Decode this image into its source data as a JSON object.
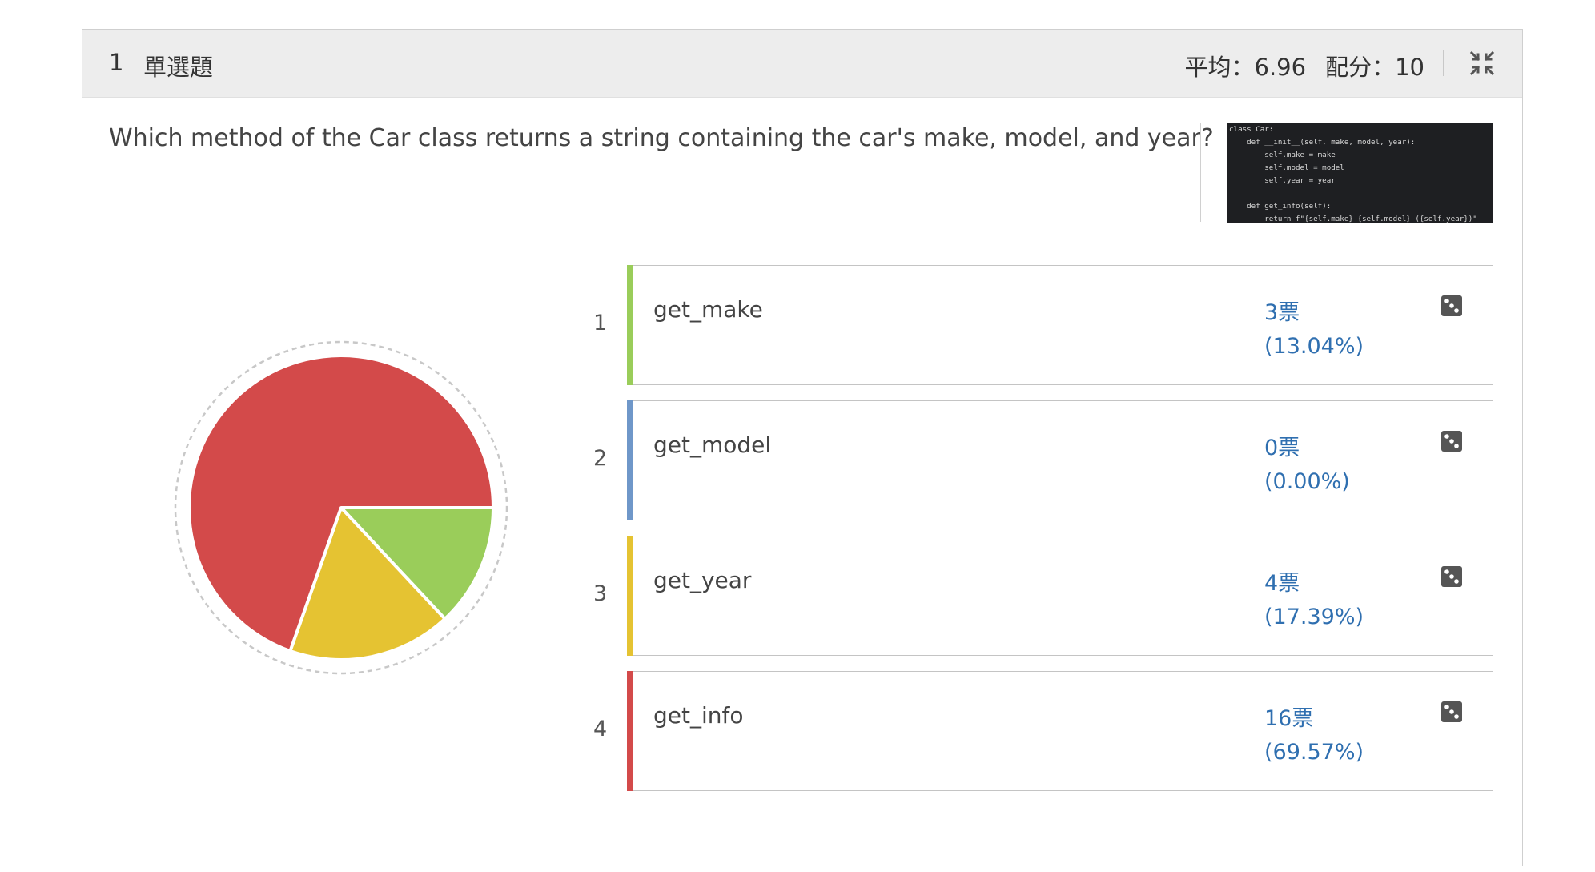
{
  "question": {
    "number": "1",
    "type": "單選題",
    "average_text": "平均：6.96",
    "score_text": "配分：10",
    "text": "Which method of the Car class returns a string containing the car's make, model, and year?",
    "code_lines": [
      "class Car:",
      "    def __init__(self, make, model, year):",
      "        self.make = make",
      "        self.model = model",
      "        self.year = year",
      "",
      "    def get_info(self):",
      "        return f\"{self.make} {self.model} ({self.year})\""
    ]
  },
  "options": [
    {
      "index": "1",
      "label": "get_make",
      "votes": "3票",
      "percent": "(13.04%)",
      "color": "#9acd5a"
    },
    {
      "index": "2",
      "label": "get_model",
      "votes": "0票",
      "percent": "(0.00%)",
      "color": "#6f97c9"
    },
    {
      "index": "3",
      "label": "get_year",
      "votes": "4票",
      "percent": "(17.39%)",
      "color": "#e5c332"
    },
    {
      "index": "4",
      "label": "get_info",
      "votes": "16票",
      "percent": "(69.57%)",
      "color": "#d34a4a"
    }
  ],
  "chart_data": {
    "type": "pie",
    "categories": [
      "get_make",
      "get_model",
      "get_year",
      "get_info"
    ],
    "values": [
      3,
      0,
      4,
      16
    ],
    "colors": [
      "#9acd5a",
      "#6f97c9",
      "#e5c332",
      "#d34a4a"
    ]
  },
  "icons": {
    "collapse": "compress-arrows-icon",
    "option_action": "dice-icon"
  }
}
